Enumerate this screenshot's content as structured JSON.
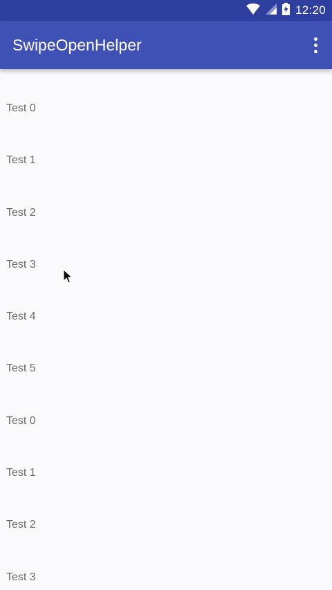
{
  "status_bar": {
    "time": "12:20",
    "icons": [
      "wifi-icon",
      "cell-signal-icon",
      "battery-charging-icon"
    ]
  },
  "app_bar": {
    "title": "SwipeOpenHelper",
    "overflow_icon": "more-vert-icon"
  },
  "list": {
    "items": [
      {
        "label": "Test 0"
      },
      {
        "label": "Test 1"
      },
      {
        "label": "Test 2"
      },
      {
        "label": "Test 3"
      },
      {
        "label": "Test 4"
      },
      {
        "label": "Test 5"
      },
      {
        "label": "Test 0"
      },
      {
        "label": "Test 1"
      },
      {
        "label": "Test 2"
      },
      {
        "label": "Test 3"
      }
    ]
  },
  "colors": {
    "primary": "#3f51b5",
    "primary_dark": "#2f3f9f",
    "background": "#fafafc",
    "item_text": "#6b6b6b"
  }
}
